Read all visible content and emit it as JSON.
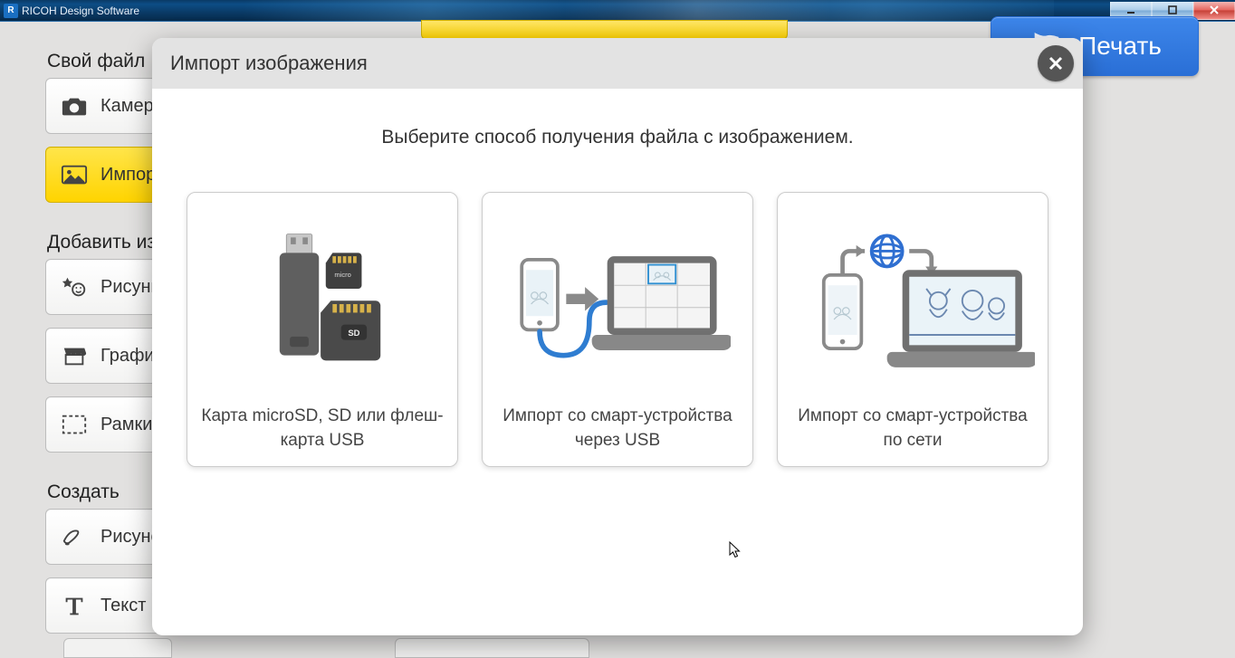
{
  "window": {
    "title": "RICOH Design Software"
  },
  "topbar": {
    "print_label": "Печать"
  },
  "sidebar": {
    "section_own_file": "Свой файл",
    "btn_camera": "Камера",
    "btn_import": "Импорт",
    "section_add_items": "Добавить из",
    "btn_drawings": "Рисунки",
    "btn_graphics": "Графика",
    "btn_frames": "Рамки",
    "section_create": "Создать",
    "btn_draw": "Рисунок",
    "btn_text": "Текст"
  },
  "modal": {
    "title": "Импорт изображения",
    "instruction": "Выберите способ получения файла с изображением.",
    "cards": [
      {
        "caption": "Карта microSD, SD или флеш-карта USB"
      },
      {
        "caption": "Импорт со смарт-устройства через USB"
      },
      {
        "caption": "Импорт со смарт-устройства по сети"
      }
    ]
  }
}
